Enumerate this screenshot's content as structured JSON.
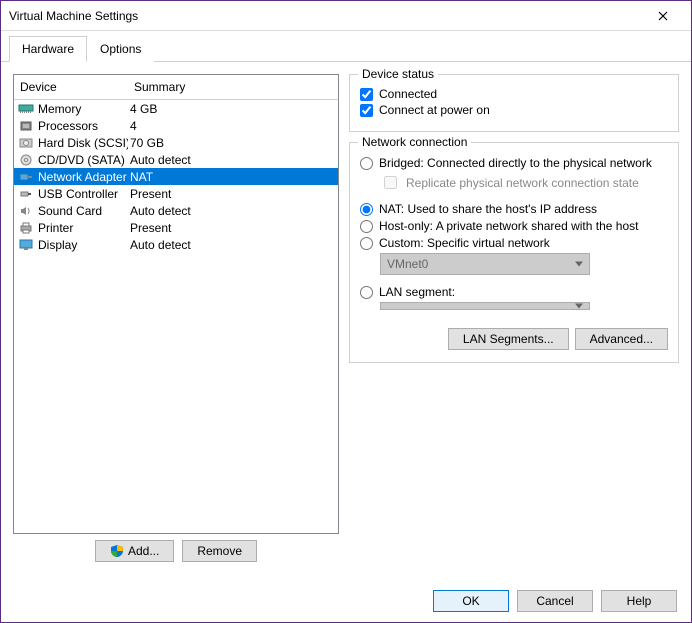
{
  "window": {
    "title": "Virtual Machine Settings"
  },
  "tabs": {
    "hardware": "Hardware",
    "options": "Options"
  },
  "list": {
    "col_device": "Device",
    "col_summary": "Summary",
    "rows": [
      {
        "name": "Memory",
        "summary": "4 GB",
        "icon": "memory"
      },
      {
        "name": "Processors",
        "summary": "4",
        "icon": "cpu"
      },
      {
        "name": "Hard Disk (SCSI)",
        "summary": "70 GB",
        "icon": "disk"
      },
      {
        "name": "CD/DVD (SATA)",
        "summary": "Auto detect",
        "icon": "cd"
      },
      {
        "name": "Network Adapter",
        "summary": "NAT",
        "icon": "net"
      },
      {
        "name": "USB Controller",
        "summary": "Present",
        "icon": "usb"
      },
      {
        "name": "Sound Card",
        "summary": "Auto detect",
        "icon": "sound"
      },
      {
        "name": "Printer",
        "summary": "Present",
        "icon": "printer"
      },
      {
        "name": "Display",
        "summary": "Auto detect",
        "icon": "display"
      }
    ],
    "selected_index": 4
  },
  "buttons": {
    "add": "Add...",
    "remove": "Remove",
    "lan_segments": "LAN Segments...",
    "advanced": "Advanced...",
    "ok": "OK",
    "cancel": "Cancel",
    "help": "Help"
  },
  "device_status": {
    "title": "Device status",
    "connected": "Connected",
    "connect_power_on": "Connect at power on"
  },
  "network": {
    "title": "Network connection",
    "bridged": "Bridged: Connected directly to the physical network",
    "replicate": "Replicate physical network connection state",
    "nat": "NAT: Used to share the host's IP address",
    "hostonly": "Host-only: A private network shared with the host",
    "custom": "Custom: Specific virtual network",
    "custom_value": "VMnet0",
    "lan": "LAN segment:",
    "lan_value": ""
  }
}
